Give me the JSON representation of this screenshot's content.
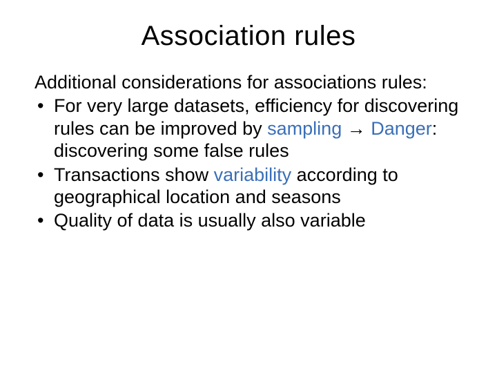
{
  "title": "Association rules",
  "intro": "Additional considerations for associations rules:",
  "bullets": {
    "b1": {
      "t1": "For very large datasets, efficiency for discovering rules can be improved by ",
      "hl1": "sampling",
      "arrow": " → ",
      "hl2": "Danger",
      "t2": ": discovering some false rules"
    },
    "b2": {
      "t1": "Transactions show ",
      "hl1": "variability",
      "t2": " according to geographical location and seasons"
    },
    "b3": {
      "t1": "Quality of data is usually also variable"
    }
  }
}
